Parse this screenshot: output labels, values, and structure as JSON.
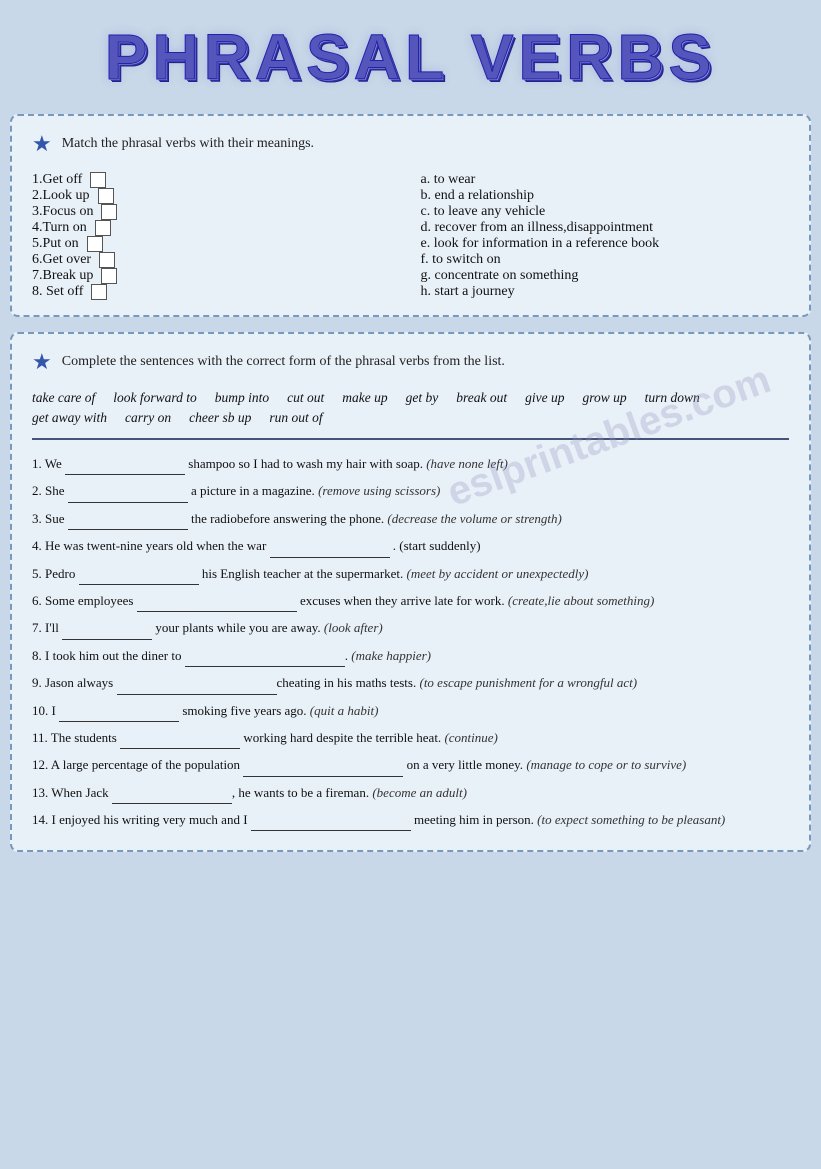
{
  "title": "PHRASAL VERBS",
  "section1": {
    "instruction": "Match the phrasal verbs with their meanings.",
    "verbs": [
      {
        "num": "1.",
        "verb": "Get off",
        "has_box": true
      },
      {
        "num": "2.",
        "verb": "Look up",
        "has_box": true
      },
      {
        "num": "3.",
        "verb": "Focus on",
        "has_box": true
      },
      {
        "num": "4.",
        "verb": "Turn on",
        "has_box": true
      },
      {
        "num": "5.",
        "verb": "Put on",
        "has_box": true
      },
      {
        "num": "6.",
        "verb": "Get over",
        "has_box": true
      },
      {
        "num": "7.",
        "verb": "Break up",
        "has_box": true
      },
      {
        "num": "8.",
        "verb": "Set off",
        "has_box": true
      }
    ],
    "meanings": [
      {
        "letter": "a.",
        "meaning": "to wear"
      },
      {
        "letter": "b.",
        "meaning": "end a relationship"
      },
      {
        "letter": "c.",
        "meaning": "to leave any vehicle"
      },
      {
        "letter": "d.",
        "meaning": "recover from an illness,disappointment"
      },
      {
        "letter": "e.",
        "meaning": "look for information in a reference book"
      },
      {
        "letter": "f.",
        "meaning": "to switch on"
      },
      {
        "letter": "g.",
        "meaning": "concentrate on something"
      },
      {
        "letter": "h.",
        "meaning": "start a journey"
      }
    ]
  },
  "section2": {
    "instruction": "Complete the sentences with the correct form of the phrasal verbs from the list.",
    "word_bank": [
      "take care of",
      "look forward to",
      "bump into",
      "cut out",
      "make up",
      "get by",
      "break out",
      "give up",
      "grow up",
      "turn down",
      "get away with",
      "carry on",
      "cheer sb up",
      "run out of"
    ],
    "sentences": [
      {
        "num": "1.",
        "pre": "We",
        "blank_size": "medium",
        "post": "shampoo so I had to wash my hair with soap.",
        "hint": "(have none left)"
      },
      {
        "num": "2.",
        "pre": "She",
        "blank_size": "medium",
        "post": "a picture in a magazine.",
        "hint": "(remove using scissors)"
      },
      {
        "num": "3.",
        "pre": "Sue",
        "blank_size": "medium",
        "post": "the radiobefore answering the phone.",
        "hint": "(decrease the volume or strength)"
      },
      {
        "num": "4.",
        "pre": "He was twent-nine years old when the war",
        "blank_size": "medium",
        "post": ". (start suddenly)",
        "hint": ""
      },
      {
        "num": "5.",
        "pre": "Pedro",
        "blank_size": "medium",
        "post": "his English teacher at the supermarket.",
        "hint": "(meet by accident or unexpectedly)"
      },
      {
        "num": "6.",
        "pre": "Some employees",
        "blank_size": "long",
        "post": "excuses when they arrive late for work.",
        "hint": "(create,lie about something)"
      },
      {
        "num": "7.",
        "pre": "I'll",
        "blank_size": "short",
        "post": "your plants while you are away.",
        "hint": "(look after)"
      },
      {
        "num": "8.",
        "pre": "I took him out the diner to",
        "blank_size": "long",
        "post": ".",
        "hint": "(make happier)"
      },
      {
        "num": "9.",
        "pre": "Jason always",
        "blank_size": "long",
        "post": "cheating in his maths tests.",
        "hint": "(to escape punishment for a wrongful act)"
      },
      {
        "num": "10.",
        "pre": "I",
        "blank_size": "medium",
        "post": "smoking five years ago.",
        "hint": "(quit a habit)"
      },
      {
        "num": "11.",
        "pre": "The students",
        "blank_size": "medium",
        "post": "working hard despite the terrible heat.",
        "hint": "(continue)"
      },
      {
        "num": "12.",
        "pre": "A large percentage of the population",
        "blank_size": "long",
        "post": "on a very little money.",
        "hint": "(manage to cope or to survive)"
      },
      {
        "num": "13.",
        "pre": "When Jack",
        "blank_size": "medium",
        "post": ", he wants to be a fireman.",
        "hint": "(become an adult)"
      },
      {
        "num": "14.",
        "pre": "I enjoyed his writing very much and I",
        "blank_size": "long",
        "post": "meeting him in person.",
        "hint": "(to expect something to be pleasant)"
      }
    ]
  },
  "watermark": "eslprintables.com"
}
